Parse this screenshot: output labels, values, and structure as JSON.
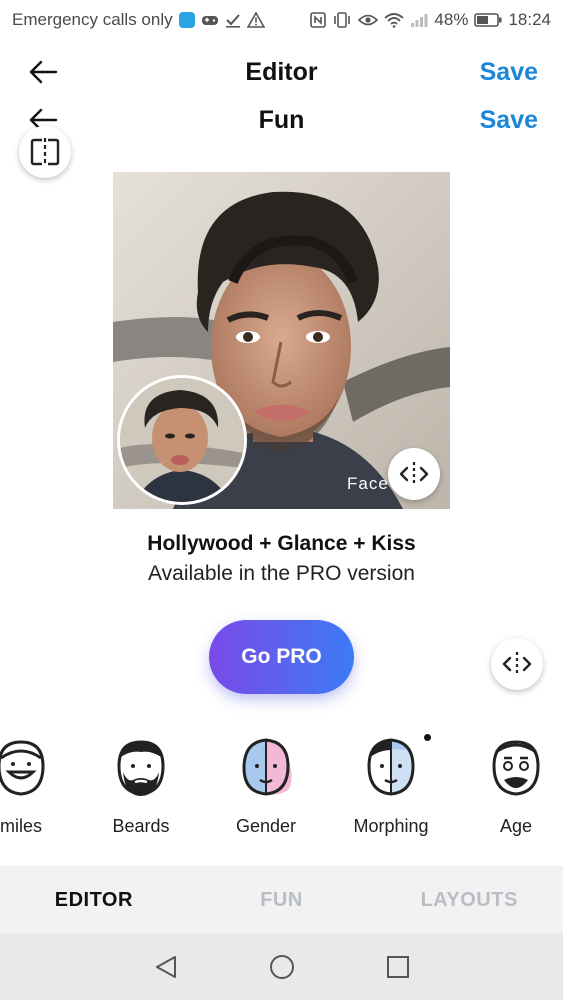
{
  "status_bar": {
    "carrier": "Emergency calls only",
    "battery": "48%",
    "time": "18:24"
  },
  "header": {
    "title": "Editor",
    "save_label": "Save",
    "sub_title": "Fun",
    "sub_save_label": "Save"
  },
  "photo": {
    "face_label": "Face"
  },
  "effect": {
    "name": "Hollywood + Glance + Kiss",
    "availability": "Available in the PRO version",
    "cta": "Go PRO"
  },
  "tools": [
    {
      "label": "miles",
      "icon": "smiles-face-icon"
    },
    {
      "label": "Beards",
      "icon": "beard-face-icon"
    },
    {
      "label": "Gender",
      "icon": "gender-face-icon"
    },
    {
      "label": "Morphing",
      "icon": "morphing-face-icon"
    },
    {
      "label": "Age",
      "icon": "age-face-icon"
    }
  ],
  "tabs": [
    "EDITOR",
    "FUN",
    "LAYOUTS"
  ],
  "active_tab": "EDITOR",
  "colors": {
    "accent": "#1a87d8",
    "pro_gradient_start": "#7a4ae8",
    "pro_gradient_end": "#3c7bf5",
    "inactive_tab": "#b9bec6"
  }
}
